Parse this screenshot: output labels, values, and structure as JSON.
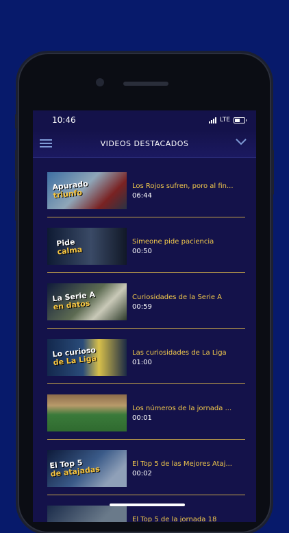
{
  "status_bar": {
    "time": "10:46",
    "network": "LTE"
  },
  "header": {
    "title": "VIDEOS DESTACADOS"
  },
  "videos": [
    {
      "title": "Los Rojos sufren, poro al fin...",
      "duration": "06:44",
      "overlay_line1": "Apurado",
      "overlay_line2": "triunfo"
    },
    {
      "title": "Simeone pide paciencia",
      "duration": "00:50",
      "overlay_line1": "Pide",
      "overlay_line2": "calma"
    },
    {
      "title": "Curiosidades de la Serie A",
      "duration": "00:59",
      "overlay_line1": "La Serie A",
      "overlay_line2": "en datos"
    },
    {
      "title": "Las curiosidades de La Liga",
      "duration": "01:00",
      "overlay_line1": "Lo curioso",
      "overlay_line2": "de La Liga"
    },
    {
      "title": "Los números de la jornada ...",
      "duration": "00:01",
      "overlay_line1": "",
      "overlay_line2": ""
    },
    {
      "title": "El Top 5 de las Mejores Ataj...",
      "duration": "00:02",
      "overlay_line1": "El Top 5",
      "overlay_line2": "de atajadas"
    },
    {
      "title": "El Top 5 de la jornada 18",
      "duration": "",
      "overlay_line1": "",
      "overlay_line2": ""
    }
  ],
  "colors": {
    "background": "#071a6b",
    "screen": "#14124a",
    "accent": "#f2c94c"
  },
  "icons": [
    "menu-icon",
    "chevron-down-icon",
    "signal-icon",
    "battery-icon"
  ]
}
